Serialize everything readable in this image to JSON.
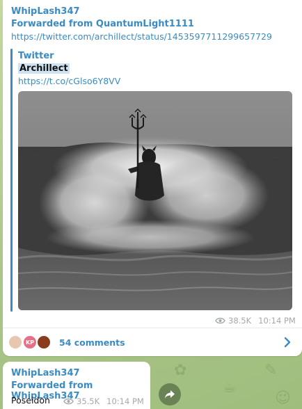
{
  "message1": {
    "sender": "WhipLash347",
    "forwarded_from": "Forwarded from QuantumLight1111",
    "link": "https://twitter.com/archillect/status/1453597711299657729",
    "preview": {
      "site_name": "Twitter",
      "title": "Archillect",
      "short_link": "https://t.co/cGlso6Y8VV"
    },
    "views": "38.5K",
    "time": "10:14 PM",
    "comments": {
      "label": "54 comments",
      "avatars": [
        {
          "initials": "",
          "color": "#e8c7b0"
        },
        {
          "initials": "KP",
          "color": "#e86f86"
        },
        {
          "initials": "",
          "color": "#8a3b1c"
        }
      ]
    }
  },
  "message2": {
    "sender": "WhipLash347",
    "forwarded_from": "Forwarded from WhipLash347",
    "text": "Poseidon",
    "views": "35.5K",
    "time": "10:14 PM"
  },
  "icons": {
    "views": "eye-icon",
    "comments_arrow": "chevron-right-icon",
    "share": "share-arrow-icon"
  },
  "colors": {
    "accent": "#3a8bc5",
    "meta": "#a3a9ae",
    "bubble": "#ffffff",
    "chat_bg": "#b9cf95"
  }
}
